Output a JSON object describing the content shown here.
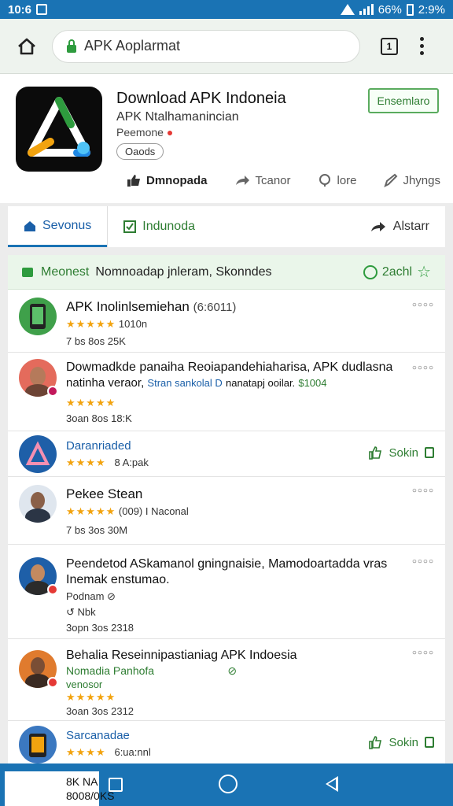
{
  "status": {
    "time": "10:6",
    "battery": "66%",
    "clock_right": "2:9%"
  },
  "browser": {
    "url": "APK Aoplarmat"
  },
  "app": {
    "title": "Download APK Indoneia",
    "subtitle": "APK Ntalhamanincian",
    "developer": "Peemone",
    "tag": "Oaods",
    "install_label": "Ensemlaro",
    "actions": [
      "Dmnopada",
      "Tcanor",
      "lore",
      "Jhyngs"
    ]
  },
  "tabs": {
    "tab1": "Sevonus",
    "tab2": "Indunoda",
    "tab3": "Alstarr"
  },
  "list": {
    "head_new": "Meonest",
    "head_text": "Nomnoadap jnleram, Skonndes",
    "head_right": "2achl",
    "items": [
      {
        "title": "APK Inolinlsemiehan",
        "rating_extra": "(6:6011)",
        "count": "1010n",
        "stat": "7 bs  8os  25K"
      },
      {
        "title_line1": "Dowmadkde panaiha Reoiapandehiaharisa, APK dudlasna",
        "title_line2_a": "natinha veraor,",
        "title_line2_b": "Stran sankolal D",
        "title_line2_c": "nanatapj ooilar.",
        "title_line2_d": "$1004",
        "stat": "3oan  8os  18:K"
      },
      {
        "title": "Daranriaded",
        "sub": "8 A:pak",
        "action": "Sokin"
      },
      {
        "title": "Pekee Stean",
        "sub": "(009) I Naconal",
        "stat": "7 bs  3os  30M"
      },
      {
        "title_line1": "Peendetod ASkamanol gningnaisie,  Mamodoartadda vras",
        "title_line2": "Inemak enstumao.",
        "sub": "Podnam",
        "sub2": "Nbk",
        "stat": "3opn  3os  2318"
      },
      {
        "title": "Behalia Reseinnipastianiag APK Indoesia",
        "sub": "Nomadia Panhofa",
        "sub2": "venosor",
        "stat": "3oan  3os  2312"
      },
      {
        "title": "Sarcanadae",
        "sub": "6:ua:nnl",
        "action": "Sokin"
      }
    ]
  },
  "nav": {
    "note": "8K NA 8008/0KS"
  },
  "colors": {
    "primary": "#1a73b4",
    "accent": "#2e7d32",
    "star": "#f2a30f"
  }
}
